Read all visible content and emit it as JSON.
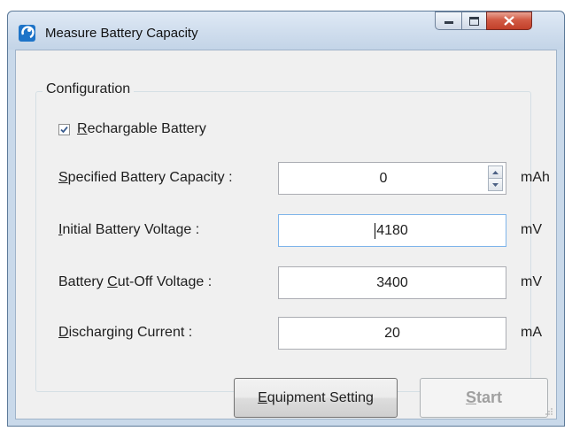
{
  "window": {
    "title": "Measure Battery Capacity",
    "icon": "app-icon"
  },
  "config": {
    "group_label": "Configuration",
    "rechargeable": {
      "checked": true,
      "label_mnemonic": "R",
      "label_rest": "echargable Battery"
    },
    "fields": [
      {
        "label_pre": "",
        "label_mnemonic": "S",
        "label_post": "pecified Battery Capacity :",
        "value": "0",
        "unit": "mAh",
        "spinner": true
      },
      {
        "label_pre": "",
        "label_mnemonic": "I",
        "label_post": "nitial Battery Voltage :",
        "value": "4180",
        "unit": "mV",
        "spinner": false
      },
      {
        "label_pre": "Battery ",
        "label_mnemonic": "C",
        "label_post": "ut-Off Voltage :",
        "value": "3400",
        "unit": "mV",
        "spinner": false
      },
      {
        "label_pre": "",
        "label_mnemonic": "D",
        "label_post": "ischarging Current :",
        "value": "20",
        "unit": "mA",
        "spinner": false
      }
    ]
  },
  "buttons": {
    "equipment": {
      "mnemonic": "E",
      "rest": "quipment Setting"
    },
    "start": {
      "mnemonic": "S",
      "rest": "tart",
      "enabled": false
    }
  },
  "colors": {
    "title_bar": "#cfdded",
    "client_bg": "#f0f0f0",
    "close_button": "#c2402a"
  }
}
